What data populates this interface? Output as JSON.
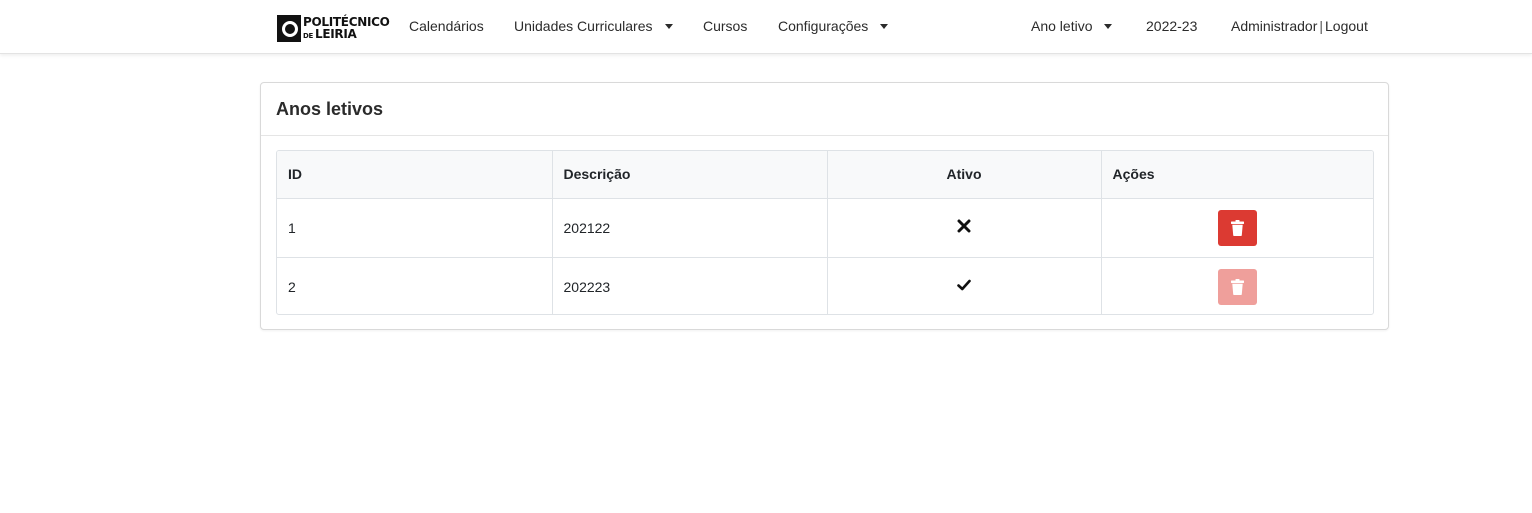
{
  "brand": {
    "line1": "POLITÉCNICO",
    "line2_small": "DE",
    "line2": "LEIRIA"
  },
  "nav": {
    "calendarios": "Calendários",
    "unidades": "Unidades Curriculares",
    "cursos": "Cursos",
    "configuracoes": "Configurações",
    "ano_letivo": "Ano letivo",
    "current_year": "2022-23",
    "user": "Administrador",
    "separator": "|",
    "logout": "Logout"
  },
  "card": {
    "title": "Anos letivos"
  },
  "table": {
    "headers": {
      "id": "ID",
      "descricao": "Descrição",
      "ativo": "Ativo",
      "acoes": "Ações"
    },
    "rows": [
      {
        "id": "1",
        "descricao": "202122",
        "ativo": false,
        "delete_enabled": true
      },
      {
        "id": "2",
        "descricao": "202223",
        "ativo": true,
        "delete_enabled": false
      }
    ]
  },
  "icons": {
    "inactive": "x-icon",
    "active": "check-icon",
    "delete": "trash-icon"
  },
  "colors": {
    "danger": "#dc3a32",
    "danger_disabled": "#ef9f9b"
  }
}
